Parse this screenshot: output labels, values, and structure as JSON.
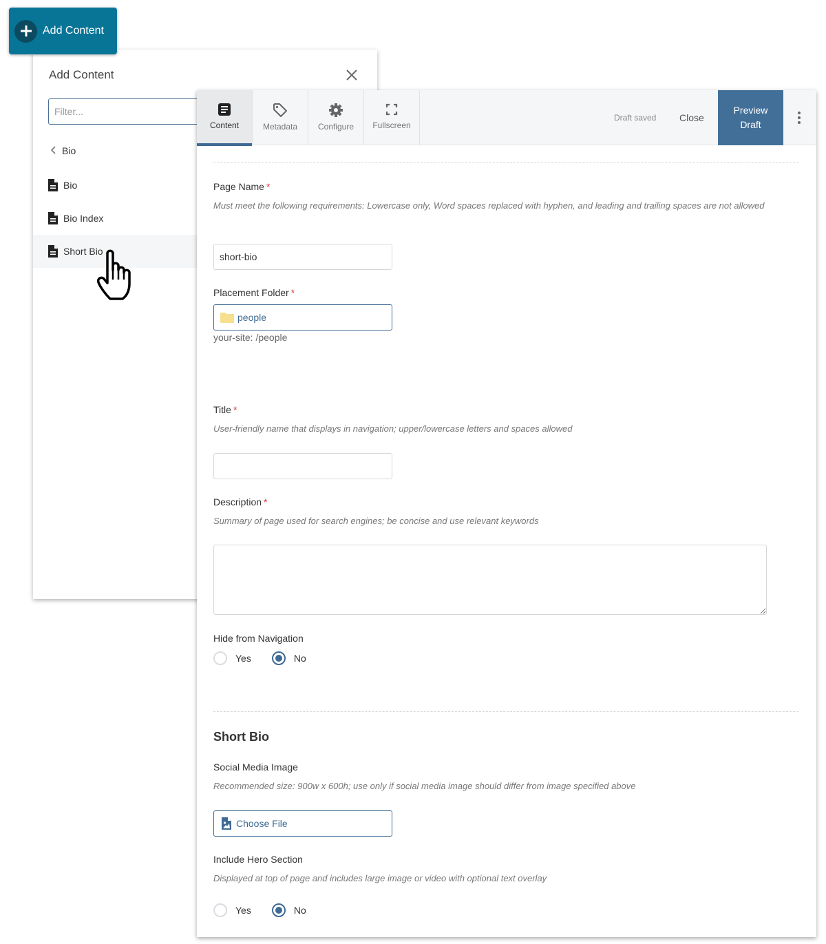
{
  "add_button": {
    "label": "Add Content",
    "icon": "plus-icon"
  },
  "left_panel": {
    "title": "Add Content",
    "close_icon": "close-icon",
    "filter_placeholder": "Filter...",
    "filter_value": "",
    "back_label": "Bio",
    "items": [
      {
        "label": "Bio",
        "icon": "document-icon"
      },
      {
        "label": "Bio Index",
        "icon": "document-icon"
      },
      {
        "label": "Short Bio",
        "icon": "document-icon",
        "hovered": true
      }
    ]
  },
  "editor": {
    "tabs": [
      {
        "label": "Content",
        "icon": "content-icon",
        "active": true
      },
      {
        "label": "Metadata",
        "icon": "tag-icon",
        "active": false
      },
      {
        "label": "Configure",
        "icon": "gear-icon",
        "active": false
      },
      {
        "label": "Fullscreen",
        "icon": "fullscreen-icon",
        "active": false
      }
    ],
    "status": "Draft saved",
    "close_label": "Close",
    "preview_line1": "Preview",
    "preview_line2": "Draft",
    "more_icon": "kebab-menu-icon",
    "fields": {
      "page_name": {
        "label": "Page Name",
        "required": "*",
        "help": "Must meet the following requirements: Lowercase only, Word spaces replaced with hyphen, and leading and trailing spaces are not allowed",
        "value": "short-bio"
      },
      "placement_folder": {
        "label": "Placement Folder",
        "required": "*",
        "value": "people",
        "path": "your-site: /people"
      },
      "title": {
        "label": "Title",
        "required": "*",
        "help": "User-friendly name that displays in navigation; upper/lowercase letters and spaces allowed",
        "value": ""
      },
      "description": {
        "label": "Description",
        "required": "*",
        "help": "Summary of page used for search engines; be concise and use relevant keywords",
        "value": ""
      },
      "hide_nav": {
        "label": "Hide from Navigation",
        "options": [
          "Yes",
          "No"
        ],
        "selected": "No"
      }
    },
    "section": {
      "title": "Short Bio",
      "social_image": {
        "label": "Social Media Image",
        "help": "Recommended size: 900w x 600h; use only if social media image should differ from image specified above",
        "button": "Choose File"
      },
      "hero": {
        "label": "Include Hero Section",
        "help": "Displayed at top of page and includes large image or video with optional text overlay",
        "options": [
          "Yes",
          "No"
        ],
        "selected": "No"
      }
    }
  }
}
